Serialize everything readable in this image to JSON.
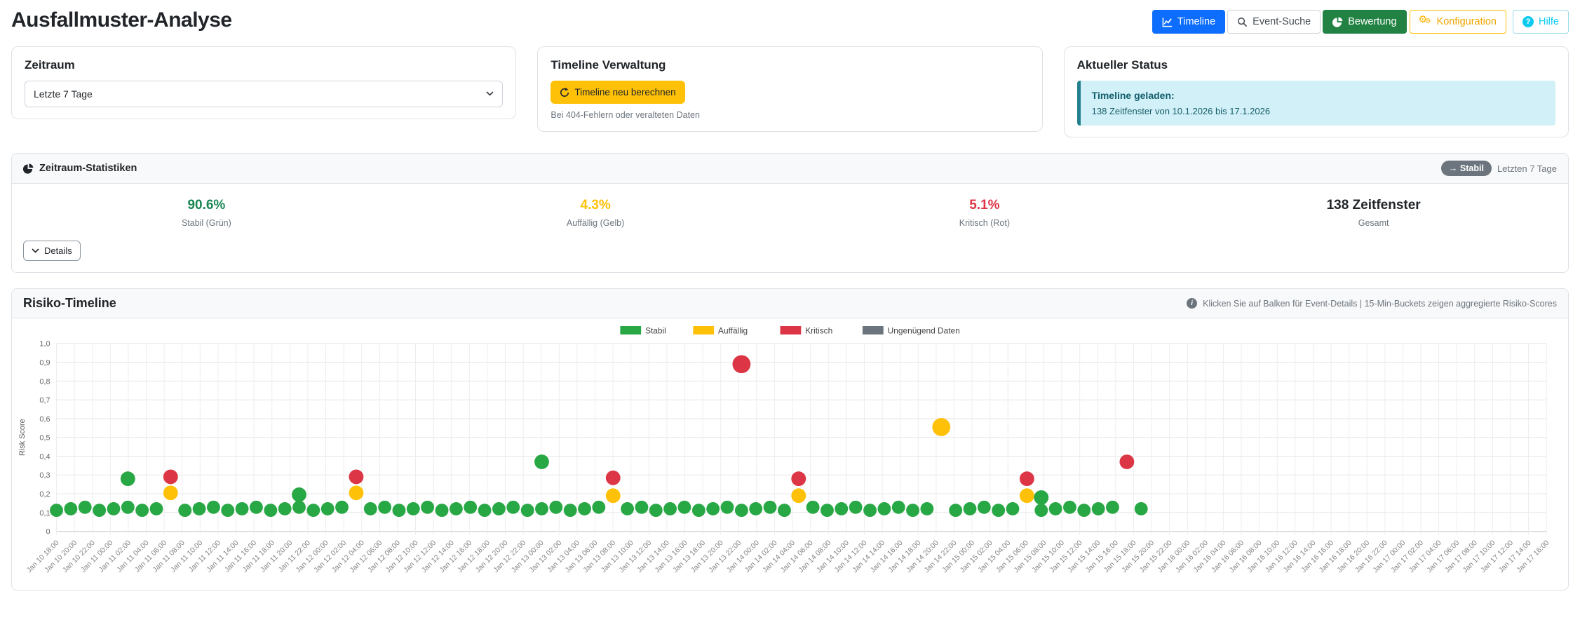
{
  "header": {
    "title": "Ausfallmuster-Analyse",
    "nav": [
      {
        "label": "Timeline",
        "icon": "line-chart-icon"
      },
      {
        "label": "Event-Suche",
        "icon": "search-icon"
      },
      {
        "label": "Bewertung",
        "icon": "pie-chart-icon"
      },
      {
        "label": "Konfiguration",
        "icon": "gears-icon"
      },
      {
        "label": "Hilfe",
        "icon": "help-icon"
      }
    ]
  },
  "cards": {
    "zeitraum": {
      "title": "Zeitraum",
      "select_value": "Letzte 7 Tage"
    },
    "verwaltung": {
      "title": "Timeline Verwaltung",
      "button_label": "Timeline neu berechnen",
      "hint": "Bei 404-Fehlern oder veralteten Daten"
    },
    "status": {
      "title": "Aktueller Status",
      "alert_title": "Timeline geladen:",
      "alert_text": "138 Zeitfenster von 10.1.2026 bis 17.1.2026"
    }
  },
  "stats": {
    "title": "Zeitraum-Statistiken",
    "trend_badge": "→ Stabil",
    "range_label": "Letzten 7 Tage",
    "details_label": "Details",
    "items": [
      {
        "value": "90.6%",
        "label": "Stabil (Grün)",
        "color": "#198754"
      },
      {
        "value": "4.3%",
        "label": "Auffällig (Gelb)",
        "color": "#ffc107"
      },
      {
        "value": "5.1%",
        "label": "Kritisch (Rot)",
        "color": "#dc3545"
      },
      {
        "value": "138 Zeitfenster",
        "label": "Gesamt",
        "color": "#212529"
      }
    ]
  },
  "timeline_section": {
    "title": "Risiko-Timeline",
    "note": "Klicken Sie auf Balken für Event-Details | 15-Min-Buckets zeigen aggregierte Risiko-Scores"
  },
  "chart_data": {
    "type": "scatter",
    "title": "Risiko-Timeline",
    "xlabel": "",
    "ylabel": "Risk Score",
    "ylim": [
      0,
      1
    ],
    "grid": true,
    "legend_position": "top-center",
    "legend": [
      {
        "label": "Stabil",
        "color": "#28a745"
      },
      {
        "label": "Auffällig",
        "color": "#ffc107"
      },
      {
        "label": "Kritisch",
        "color": "#dc3545"
      },
      {
        "label": "Ungenügend Daten",
        "color": "#6c757d"
      }
    ],
    "y_ticks": [
      "0",
      "0,1",
      "0,2",
      "0,3",
      "0,4",
      "0,5",
      "0,6",
      "0,7",
      "0,8",
      "0,9",
      "1,0"
    ],
    "x_ticks": [
      "Jan 10 18:00",
      "Jan 10 20:00",
      "Jan 10 22:00",
      "Jan 11 00:00",
      "Jan 11 02:00",
      "Jan 11 04:00",
      "Jan 11 06:00",
      "Jan 11 08:00",
      "Jan 11 10:00",
      "Jan 11 12:00",
      "Jan 11 14:00",
      "Jan 11 16:00",
      "Jan 11 18:00",
      "Jan 11 20:00",
      "Jan 11 22:00",
      "Jan 12 00:00",
      "Jan 12 02:00",
      "Jan 12 04:00",
      "Jan 12 06:00",
      "Jan 12 08:00",
      "Jan 12 10:00",
      "Jan 12 12:00",
      "Jan 12 14:00",
      "Jan 12 16:00",
      "Jan 12 18:00",
      "Jan 12 20:00",
      "Jan 12 22:00",
      "Jan 13 00:00",
      "Jan 13 02:00",
      "Jan 13 04:00",
      "Jan 13 06:00",
      "Jan 13 08:00",
      "Jan 13 10:00",
      "Jan 13 12:00",
      "Jan 13 14:00",
      "Jan 13 16:00",
      "Jan 13 18:00",
      "Jan 13 20:00",
      "Jan 13 22:00",
      "Jan 14 00:00",
      "Jan 14 02:00",
      "Jan 14 04:00",
      "Jan 14 06:00",
      "Jan 14 08:00",
      "Jan 14 10:00",
      "Jan 14 12:00",
      "Jan 14 14:00",
      "Jan 14 16:00",
      "Jan 14 18:00",
      "Jan 14 20:00",
      "Jan 14 22:00",
      "Jan 15 00:00",
      "Jan 15 02:00",
      "Jan 15 04:00",
      "Jan 15 06:00",
      "Jan 15 08:00",
      "Jan 15 10:00",
      "Jan 15 12:00",
      "Jan 15 14:00",
      "Jan 15 16:00",
      "Jan 15 18:00",
      "Jan 15 20:00",
      "Jan 15 22:00",
      "Jan 16 00:00",
      "Jan 16 02:00",
      "Jan 16 04:00",
      "Jan 16 06:00",
      "Jan 16 08:00",
      "Jan 16 10:00",
      "Jan 16 12:00",
      "Jan 16 14:00",
      "Jan 16 16:00",
      "Jan 16 18:00",
      "Jan 16 20:00",
      "Jan 16 22:00",
      "Jan 17 00:00",
      "Jan 17 02:00",
      "Jan 17 04:00",
      "Jan 17 06:00",
      "Jan 17 08:00",
      "Jan 17 10:00",
      "Jan 17 12:00",
      "Jan 17 14:00",
      "Jan 17 16:00"
    ],
    "baseline": {
      "status": "Stabil",
      "value": 0.12,
      "jitter": 0.008,
      "count": 77,
      "tick_ratio": 0.795,
      "gaps": [
        8,
        21,
        39,
        52,
        62,
        68,
        75
      ]
    },
    "outliers": [
      {
        "slot": 5,
        "value": 0.28,
        "status": "Stabil"
      },
      {
        "slot": 8,
        "value": 0.29,
        "status": "Kritisch"
      },
      {
        "slot": 8,
        "value": 0.205,
        "status": "Auffällig"
      },
      {
        "slot": 17,
        "value": 0.195,
        "status": "Stabil"
      },
      {
        "slot": 21,
        "value": 0.29,
        "status": "Kritisch"
      },
      {
        "slot": 21,
        "value": 0.205,
        "status": "Auffällig"
      },
      {
        "slot": 34,
        "value": 0.37,
        "status": "Stabil"
      },
      {
        "slot": 39,
        "value": 0.285,
        "status": "Kritisch"
      },
      {
        "slot": 39,
        "value": 0.19,
        "status": "Auffällig"
      },
      {
        "slot": 48,
        "value": 0.89,
        "status": "Kritisch",
        "size": "large"
      },
      {
        "slot": 52,
        "value": 0.28,
        "status": "Kritisch"
      },
      {
        "slot": 52,
        "value": 0.19,
        "status": "Auffällig"
      },
      {
        "slot": 62,
        "value": 0.555,
        "status": "Auffällig",
        "size": "large"
      },
      {
        "slot": 68,
        "value": 0.28,
        "status": "Kritisch"
      },
      {
        "slot": 68,
        "value": 0.19,
        "status": "Auffällig"
      },
      {
        "slot": 69,
        "value": 0.18,
        "status": "Stabil"
      },
      {
        "slot": 75,
        "value": 0.37,
        "status": "Kritisch"
      }
    ]
  }
}
